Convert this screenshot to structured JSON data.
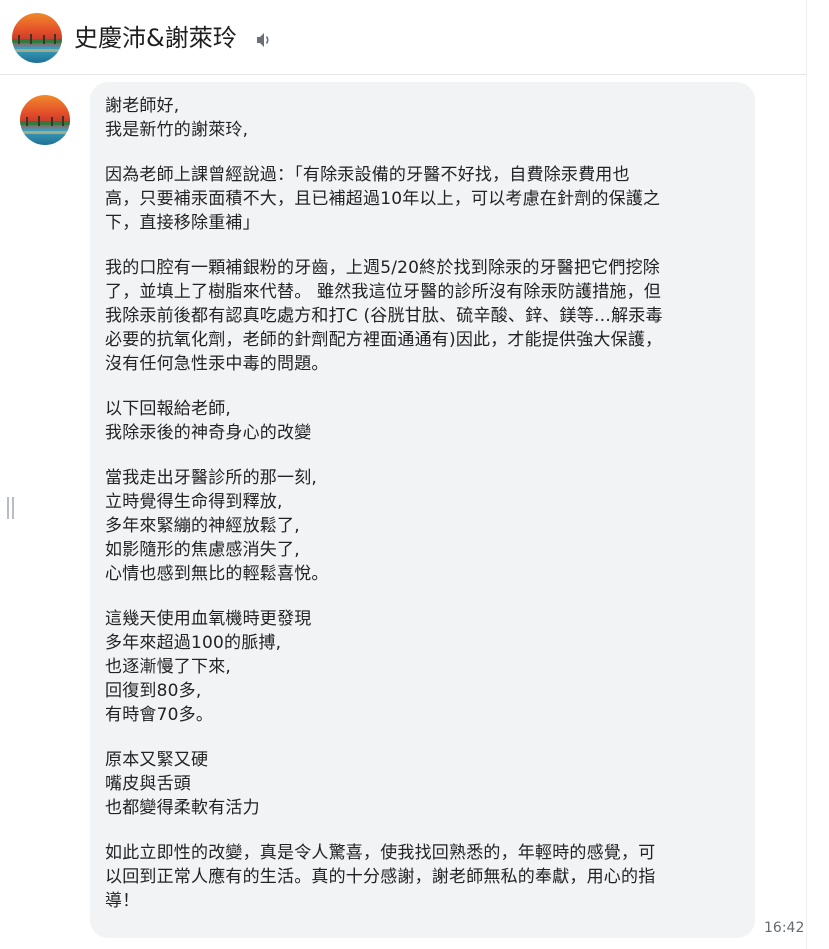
{
  "header": {
    "title": "史慶沛&謝萊玲",
    "sound_icon": "speaker-icon"
  },
  "message": {
    "time": "16:42",
    "paragraphs": [
      {
        "lines": [
          "謝老師好,",
          "我是新竹的謝萊玲,"
        ]
      },
      {
        "lines": [
          "因為老師上課曾經說過：「有除汞設備的牙醫不好找，自費除汞費用也",
          "高，只要補汞面積不大，且已補超過10年以上，可以考慮在針劑的保護之",
          "下，直接移除重補」"
        ]
      },
      {
        "lines": [
          "我的口腔有一顆補銀粉的牙齒，上週5/20終於找到除汞的牙醫把它們挖除",
          "了，並填上了樹脂來代替。 雖然我這位牙醫的診所沒有除汞防護措施，但",
          "我除汞前後都有認真吃處方和打C (谷胱甘肽、硫辛酸、鋅、鎂等…解汞毒",
          "必要的抗氧化劑，老師的針劑配方裡面通通有)因此，才能提供強大保護，",
          "沒有任何急性汞中毒的問題。"
        ]
      },
      {
        "lines": [
          "以下回報給老師,",
          "我除汞後的神奇身心的改變"
        ]
      },
      {
        "lines": [
          "當我走出牙醫診所的那一刻,",
          "立時覺得生命得到釋放,",
          "多年來緊繃的神經放鬆了,",
          "如影隨形的焦慮感消失了,",
          "心情也感到無比的輕鬆喜悅。"
        ]
      },
      {
        "lines": [
          "這幾天使用血氧機時更發現",
          "多年來超過100的脈搏,",
          "也逐漸慢了下來,",
          "回復到80多,",
          "有時會70多。"
        ]
      },
      {
        "lines": [
          "原本又緊又硬",
          "嘴皮與舌頭",
          "也都變得柔軟有活力"
        ]
      },
      {
        "lines": [
          "如此立即性的改變，真是令人驚喜，使我找回熟悉的，年輕時的感覺，可",
          "以回到正常人應有的生活。真的十分感謝，謝老師無私的奉獻，用心的指",
          "導！"
        ]
      }
    ]
  }
}
